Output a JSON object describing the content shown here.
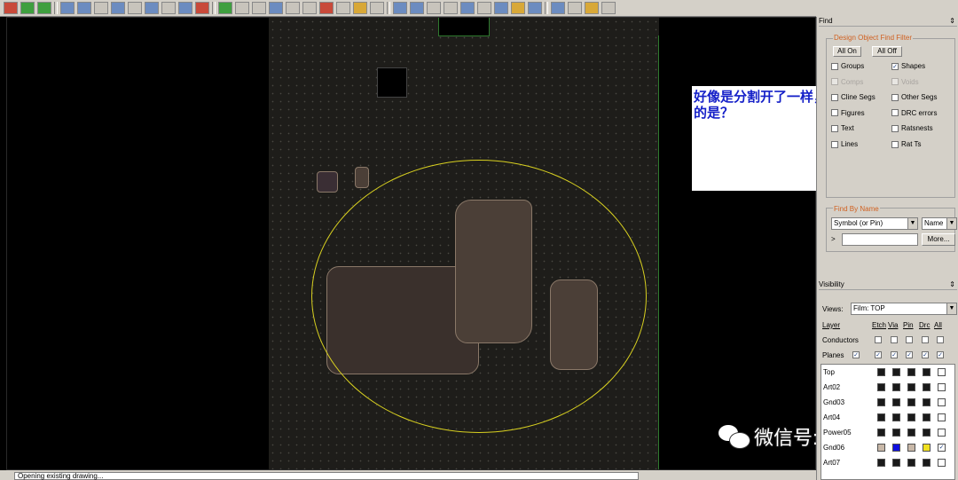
{
  "canvas": {
    "board_color": "#1e1d1a",
    "ring_color": "#d8d020",
    "outline_color": "#2f7a2f"
  },
  "annotation": {
    "text": "好像是分割开了一样，这样做的目的是？",
    "color": "#1520c8"
  },
  "watermark": {
    "text": "微信号: RF-COM"
  },
  "status": {
    "text": "Opening existing drawing..."
  },
  "find_panel": {
    "title": "Find",
    "filter_title": "Design Object Find Filter",
    "all_on": "All On",
    "all_off": "All Off",
    "filters": [
      {
        "label": "Groups",
        "checked": false,
        "enabled": true
      },
      {
        "label": "Shapes",
        "checked": true,
        "enabled": true
      },
      {
        "label": "Comps",
        "checked": false,
        "enabled": false
      },
      {
        "label": "Voids",
        "checked": false,
        "enabled": false
      },
      {
        "label": "Cline Segs",
        "checked": false,
        "enabled": true
      },
      {
        "label": "Other Segs",
        "checked": false,
        "enabled": true
      },
      {
        "label": "Figures",
        "checked": false,
        "enabled": true
      },
      {
        "label": "DRC errors",
        "checked": false,
        "enabled": true
      },
      {
        "label": "Text",
        "checked": false,
        "enabled": true
      },
      {
        "label": "Ratsnests",
        "checked": false,
        "enabled": true
      },
      {
        "label": "Lines",
        "checked": false,
        "enabled": true
      },
      {
        "label": "Rat Ts",
        "checked": false,
        "enabled": true
      }
    ],
    "find_by_name_title": "Find By Name",
    "symbol_select": "Symbol (or Pin)",
    "name_select": "Name",
    "prompt": ">",
    "name_value": "",
    "more_button": "More..."
  },
  "visibility_panel": {
    "title": "Visibility",
    "views_label": "Views:",
    "views_value": "Film: TOP",
    "layer_header": "Layer",
    "columns": [
      "Etch",
      "Via",
      "Pin",
      "Drc",
      "All"
    ],
    "conductors_label": "Conductors",
    "planes_label": "Planes",
    "layers": [
      {
        "name": "Top",
        "colors": [
          "#1a1a1a",
          "#1a1a1a",
          "#1a1a1a",
          "#1a1a1a"
        ]
      },
      {
        "name": "Art02",
        "colors": [
          "#1a1a1a",
          "#1a1a1a",
          "#1a1a1a",
          "#1a1a1a"
        ]
      },
      {
        "name": "Gnd03",
        "colors": [
          "#1a1a1a",
          "#1a1a1a",
          "#1a1a1a",
          "#1a1a1a"
        ]
      },
      {
        "name": "Art04",
        "colors": [
          "#1a1a1a",
          "#1a1a1a",
          "#1a1a1a",
          "#1a1a1a"
        ]
      },
      {
        "name": "Power05",
        "colors": [
          "#1a1a1a",
          "#1a1a1a",
          "#1a1a1a",
          "#1a1a1a"
        ]
      },
      {
        "name": "Gnd06",
        "colors": [
          "#c8b8a8",
          "#1010e0",
          "#c8b8a8",
          "#f0e020"
        ]
      },
      {
        "name": "Art07",
        "colors": [
          "#1a1a1a",
          "#1a1a1a",
          "#1a1a1a",
          "#1a1a1a"
        ]
      }
    ]
  }
}
